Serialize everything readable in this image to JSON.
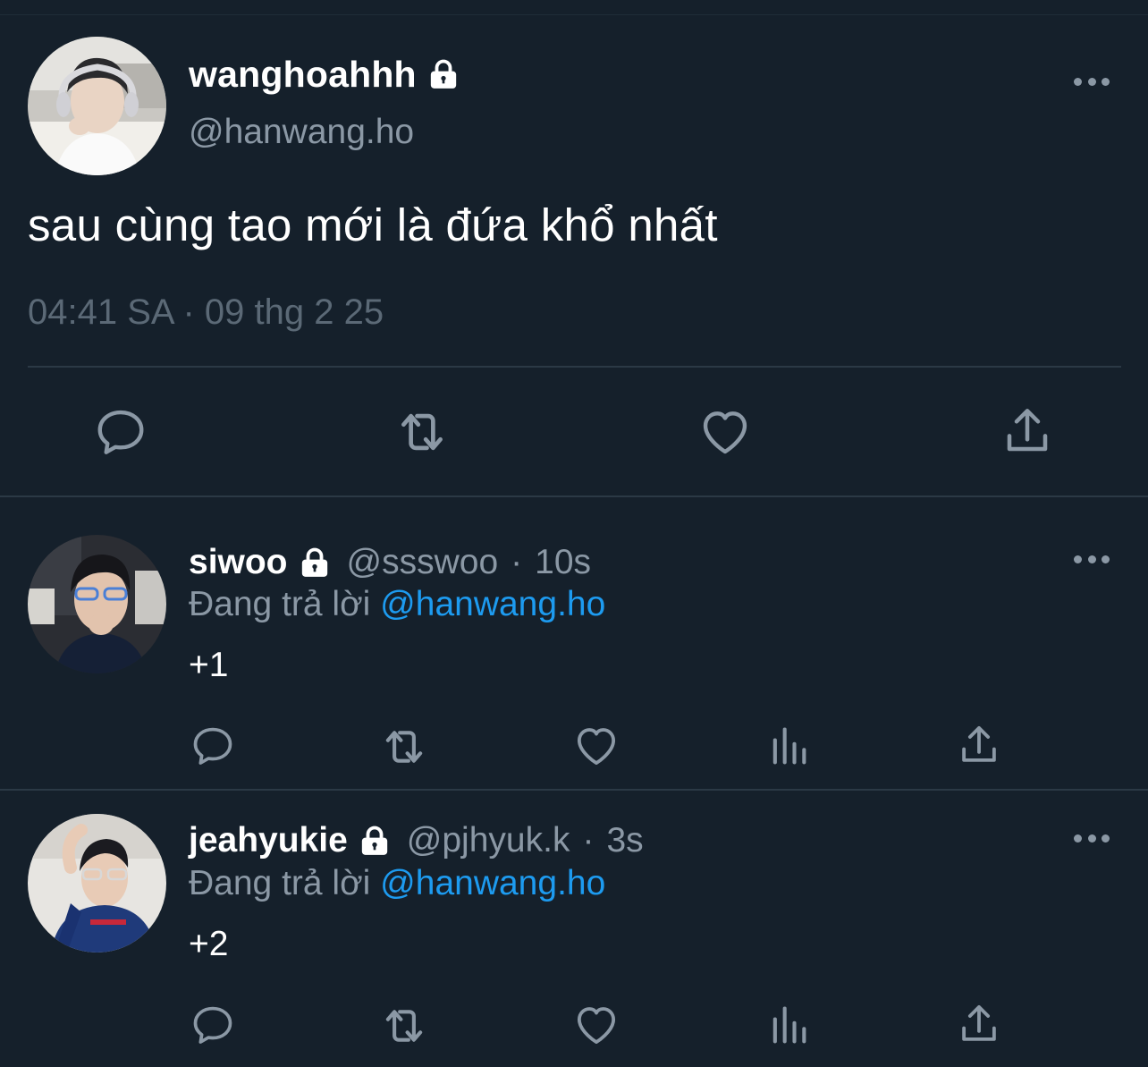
{
  "main_tweet": {
    "display_name": "wanghoahhh",
    "handle": "@hanwang.ho",
    "text": "sau cùng tao mới là đứa khổ nhất",
    "timestamp": "04:41 SA · 09 thg 2 25",
    "actions": [
      "reply-icon",
      "retweet-icon",
      "like-icon",
      "share-icon"
    ]
  },
  "replies": [
    {
      "display_name": "siwoo",
      "handle": "@ssswoo",
      "separator": "·",
      "age": "10s",
      "replying_prefix": "Đang trả lời",
      "replying_to": "@hanwang.ho",
      "text": "+1",
      "actions": [
        "reply-icon",
        "retweet-icon",
        "like-icon",
        "views-icon",
        "share-icon"
      ]
    },
    {
      "display_name": "jeahyukie",
      "handle": "@pjhyuk.k",
      "separator": "·",
      "age": "3s",
      "replying_prefix": "Đang trả lời",
      "replying_to": "@hanwang.ho",
      "text": "+2",
      "actions": [
        "reply-icon",
        "retweet-icon",
        "like-icon",
        "views-icon",
        "share-icon"
      ]
    }
  ],
  "colors": {
    "background": "#15202b",
    "secondary_text": "#8b98a5",
    "link": "#1d9bf0",
    "divider": "#2b3945"
  }
}
